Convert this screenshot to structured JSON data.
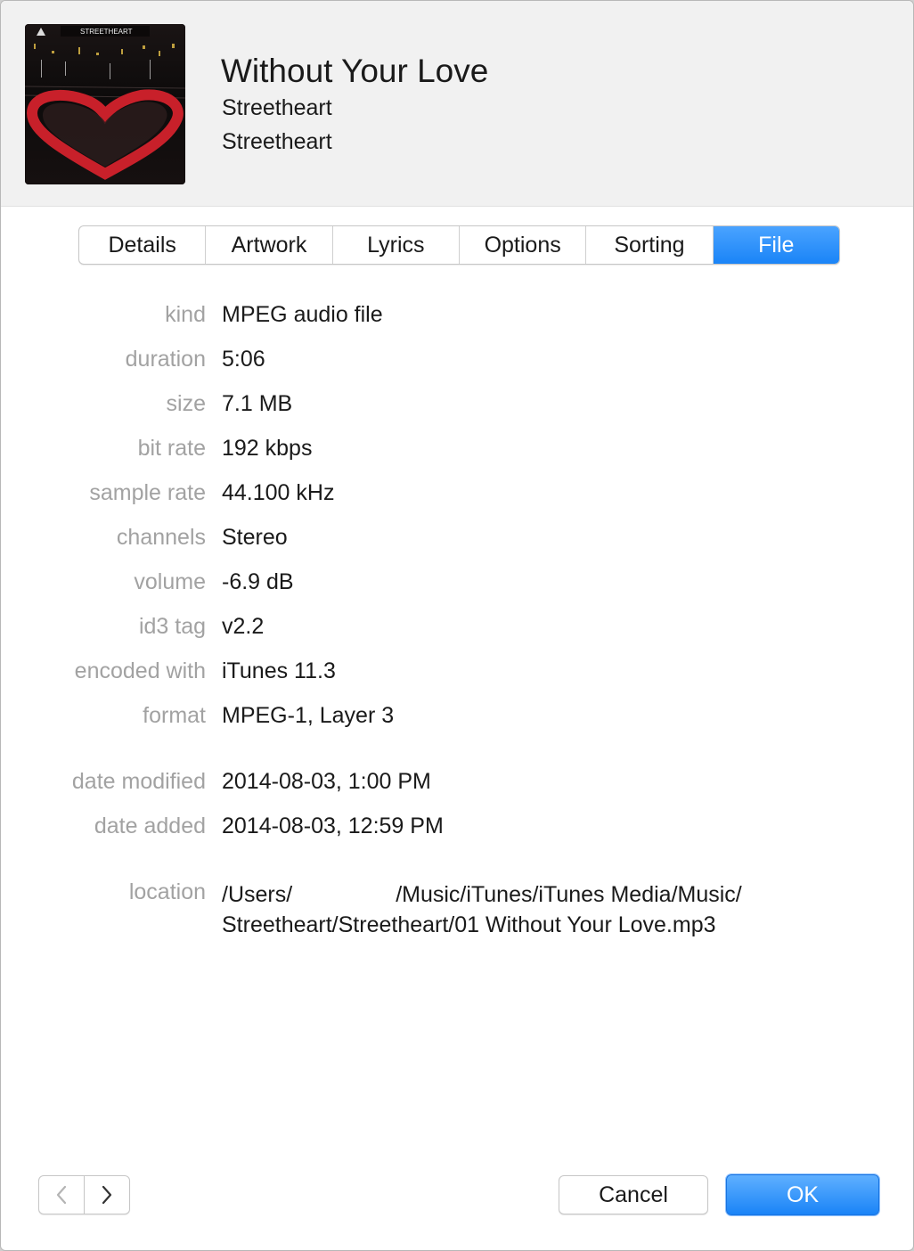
{
  "header": {
    "title": "Without Your Love",
    "artist": "Streetheart",
    "album": "Streetheart",
    "artwork_text": "STREETHEART"
  },
  "tabs": [
    {
      "label": "Details",
      "active": false
    },
    {
      "label": "Artwork",
      "active": false
    },
    {
      "label": "Lyrics",
      "active": false
    },
    {
      "label": "Options",
      "active": false
    },
    {
      "label": "Sorting",
      "active": false
    },
    {
      "label": "File",
      "active": true
    }
  ],
  "file_info": {
    "kind": {
      "label": "kind",
      "value": "MPEG audio file"
    },
    "duration": {
      "label": "duration",
      "value": "5:06"
    },
    "size": {
      "label": "size",
      "value": "7.1 MB"
    },
    "bit_rate": {
      "label": "bit rate",
      "value": "192 kbps"
    },
    "sample_rate": {
      "label": "sample rate",
      "value": "44.100 kHz"
    },
    "channels": {
      "label": "channels",
      "value": "Stereo"
    },
    "volume": {
      "label": "volume",
      "value": "-6.9 dB"
    },
    "id3_tag": {
      "label": "id3 tag",
      "value": "v2.2"
    },
    "encoded_with": {
      "label": "encoded with",
      "value": "iTunes 11.3"
    },
    "format": {
      "label": "format",
      "value": "MPEG-1, Layer 3"
    },
    "date_modified": {
      "label": "date modified",
      "value": "2014-08-03, 1:00 PM"
    },
    "date_added": {
      "label": "date added",
      "value": "2014-08-03, 12:59 PM"
    },
    "location": {
      "label": "location",
      "value_line1_start": "/Users/",
      "value_line1_end": "/Music/iTunes/iTunes Media/Music/",
      "value_line2": "Streetheart/Streetheart/01 Without Your Love.mp3"
    }
  },
  "footer": {
    "prev_icon": "chevron-left-icon",
    "next_icon": "chevron-right-icon",
    "cancel_label": "Cancel",
    "ok_label": "OK"
  },
  "colors": {
    "accent": "#1a84f7",
    "label_gray": "#a2a2a2",
    "header_bg": "#f1f1f1"
  }
}
